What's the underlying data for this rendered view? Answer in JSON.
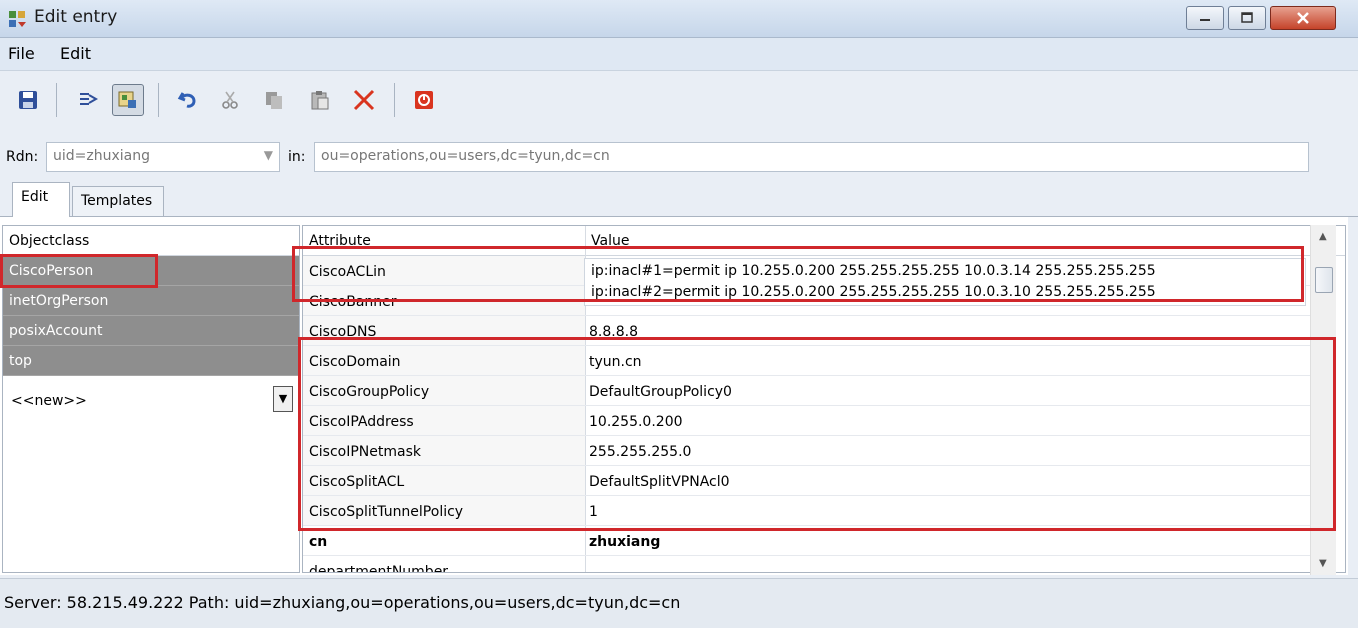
{
  "window": {
    "title": "Edit entry"
  },
  "menu": {
    "file": "File",
    "edit": "Edit"
  },
  "toolbar": {
    "icons": [
      "save-icon",
      "move-icon",
      "entry-view-icon",
      "undo-icon",
      "cut-icon",
      "copy-icon",
      "paste-icon",
      "delete-icon",
      "stop-icon"
    ]
  },
  "rdn": {
    "label": "Rdn:",
    "value": "uid=zhuxiang"
  },
  "in": {
    "label": "in:",
    "value": "ou=operations,ou=users,dc=tyun,dc=cn"
  },
  "tabs": [
    {
      "label": "Edit"
    },
    {
      "label": "Templates"
    }
  ],
  "objectclass": {
    "header": "Objectclass",
    "items": [
      "CiscoPerson",
      "inetOrgPerson",
      "posixAccount",
      "top"
    ],
    "new_item": "<<new>>"
  },
  "attributes": {
    "header_attr": "Attribute",
    "header_value": "Value",
    "rows": [
      {
        "name": "CiscoACLin",
        "value": ""
      },
      {
        "name": "CiscoBanner",
        "value": ""
      },
      {
        "name": "CiscoDNS",
        "value": "8.8.8.8"
      },
      {
        "name": "CiscoDomain",
        "value": "tyun.cn"
      },
      {
        "name": "CiscoGroupPolicy",
        "value": "DefaultGroupPolicy0"
      },
      {
        "name": "CiscoIPAddress",
        "value": "10.255.0.200"
      },
      {
        "name": "CiscoIPNetmask",
        "value": "255.255.255.0"
      },
      {
        "name": "CiscoSplitACL",
        "value": "DefaultSplitVPNAcl0"
      },
      {
        "name": "CiscoSplitTunnelPolicy",
        "value": "1"
      },
      {
        "name": "cn",
        "value": "zhuxiang"
      },
      {
        "name": "departmentNumber",
        "value": ""
      }
    ],
    "acl_lines": [
      "ip:inacl#1=permit ip 10.255.0.200 255.255.255.255 10.0.3.14 255.255.255.255",
      "ip:inacl#2=permit ip 10.255.0.200 255.255.255.255 10.0.3.10 255.255.255.255"
    ]
  },
  "status": {
    "text": "Server: 58.215.49.222  Path: uid=zhuxiang,ou=operations,ou=users,dc=tyun,dc=cn"
  },
  "colors": {
    "highlight": "#d0272b",
    "selected_row": "#8e8e8e"
  }
}
